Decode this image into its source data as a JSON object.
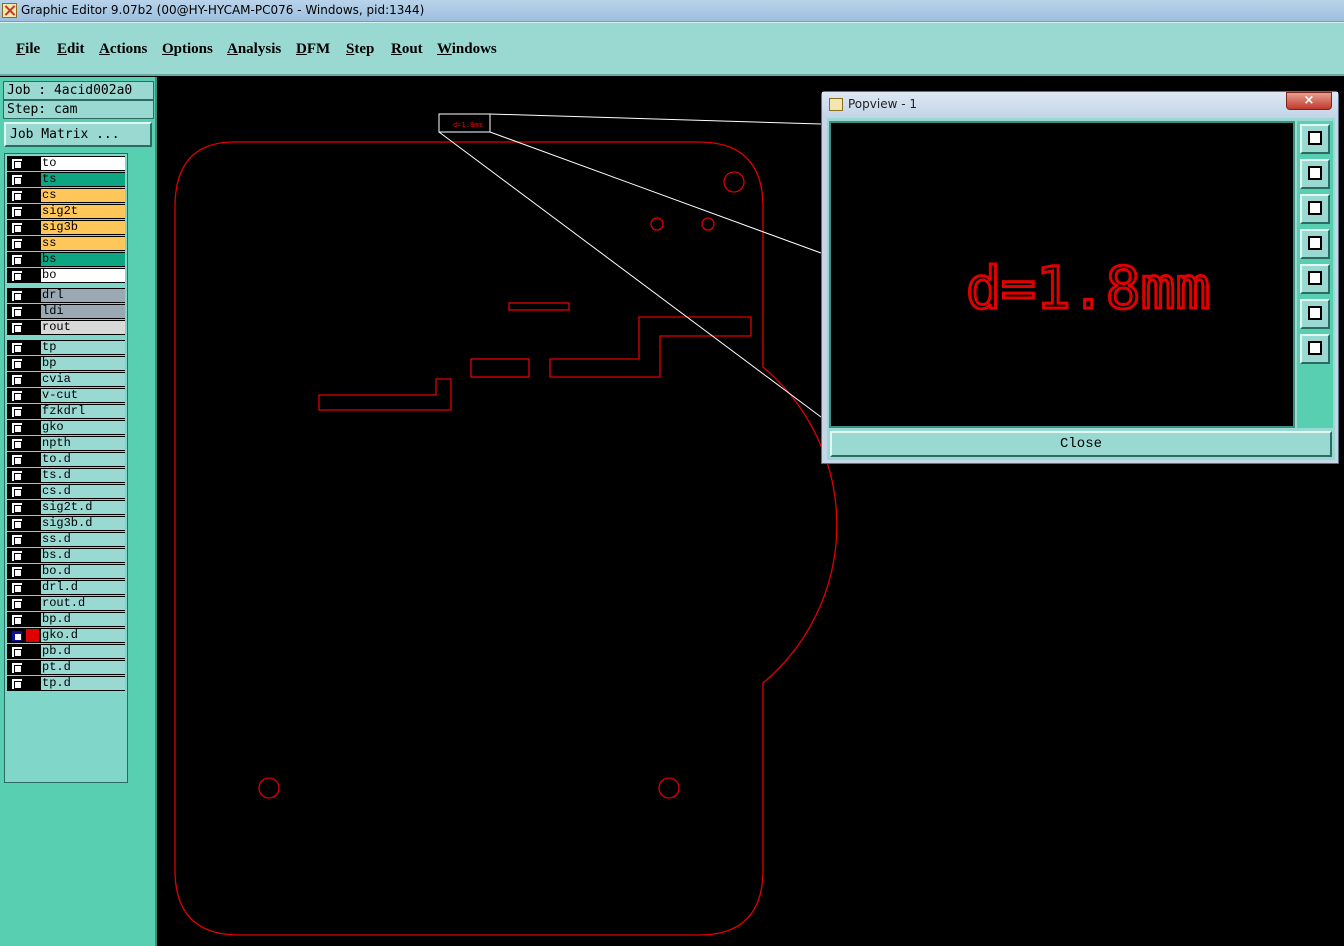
{
  "window": {
    "title": "Graphic Editor 9.07b2 (00@HY-HYCAM-PC076 - Windows, pid:1344)"
  },
  "menu": [
    "File",
    "Edit",
    "Actions",
    "Options",
    "Analysis",
    "DFM",
    "Step",
    "Rout",
    "Windows"
  ],
  "job": {
    "label": "Job : 4acid002a0",
    "step": "Step: cam",
    "matrix_button": "Job Matrix ..."
  },
  "colors": {
    "board": "#e00000",
    "panel": "#58cfb0",
    "field": "#9ad8d2",
    "signal": "#ffc65a",
    "mask": "#0da582",
    "drill": "#9aa8b4",
    "rout": "#d9d9d9"
  },
  "layers": [
    {
      "name": "to",
      "color": "#ffffff",
      "flag": "✍"
    },
    {
      "name": "ts",
      "color": "#0da582",
      "flag": ""
    },
    {
      "name": "cs",
      "color": "#ffc65a",
      "flag": "✍"
    },
    {
      "name": "sig2t",
      "color": "#ffc65a",
      "flag": "✍"
    },
    {
      "name": "sig3b",
      "color": "#ffc65a",
      "flag": "✍"
    },
    {
      "name": "ss",
      "color": "#ffc65a",
      "flag": "✍"
    },
    {
      "name": "bs",
      "color": "#0da582",
      "flag": ""
    },
    {
      "name": "bo",
      "color": "#ffffff",
      "flag": "✍"
    },
    {
      "name": "drl",
      "color": "#9aa8b4",
      "flag": "",
      "gap": true
    },
    {
      "name": "ldi",
      "color": "#9aa8b4",
      "flag": ""
    },
    {
      "name": "rout",
      "color": "#d9d9d9",
      "flag": ""
    },
    {
      "name": "tp",
      "color": "#9ad8d2",
      "flag": "",
      "gap": true
    },
    {
      "name": "bp",
      "color": "#9ad8d2",
      "flag": ""
    },
    {
      "name": "cvia",
      "color": "#9ad8d2",
      "flag": ""
    },
    {
      "name": "v-cut",
      "color": "#9ad8d2",
      "flag": ""
    },
    {
      "name": "fzkdrl",
      "color": "#9ad8d2",
      "flag": ""
    },
    {
      "name": "gko",
      "color": "#9ad8d2",
      "flag": "✍"
    },
    {
      "name": "npth",
      "color": "#9ad8d2",
      "flag": ""
    },
    {
      "name": "to.d",
      "color": "#9ad8d2",
      "flag": "✍"
    },
    {
      "name": "ts.d",
      "color": "#9ad8d2",
      "flag": ""
    },
    {
      "name": "cs.d",
      "color": "#9ad8d2",
      "flag": "✍"
    },
    {
      "name": "sig2t.d",
      "color": "#9ad8d2",
      "flag": "✍"
    },
    {
      "name": "sig3b.d",
      "color": "#9ad8d2",
      "flag": "✍"
    },
    {
      "name": "ss.d",
      "color": "#9ad8d2",
      "flag": "✍"
    },
    {
      "name": "bs.d",
      "color": "#9ad8d2",
      "flag": ""
    },
    {
      "name": "bo.d",
      "color": "#9ad8d2",
      "flag": "✍"
    },
    {
      "name": "drl.d",
      "color": "#9ad8d2",
      "flag": ""
    },
    {
      "name": "rout.d",
      "color": "#9ad8d2",
      "flag": ""
    },
    {
      "name": "bp.d",
      "color": "#9ad8d2",
      "flag": ""
    },
    {
      "name": "gko.d",
      "color": "#9ad8d2",
      "flag": "✍",
      "flag2": "⊞",
      "selected": true
    },
    {
      "name": "pb.d",
      "color": "#9ad8d2",
      "flag": ""
    },
    {
      "name": "pt.d",
      "color": "#9ad8d2",
      "flag": ""
    },
    {
      "name": "tp.d",
      "color": "#9ad8d2",
      "flag": ""
    }
  ],
  "canvas": {
    "small_label": "d=1.8mm"
  },
  "popview": {
    "title": "Popview - 1",
    "close_x": "×",
    "text": "d=1.8mm",
    "close_button": "Close",
    "tools": [
      "zoom-window-icon",
      "move-up-icon",
      "move-down-icon",
      "move-left-icon",
      "move-right-icon",
      "zoom-in-icon",
      "zoom-out-icon"
    ]
  }
}
